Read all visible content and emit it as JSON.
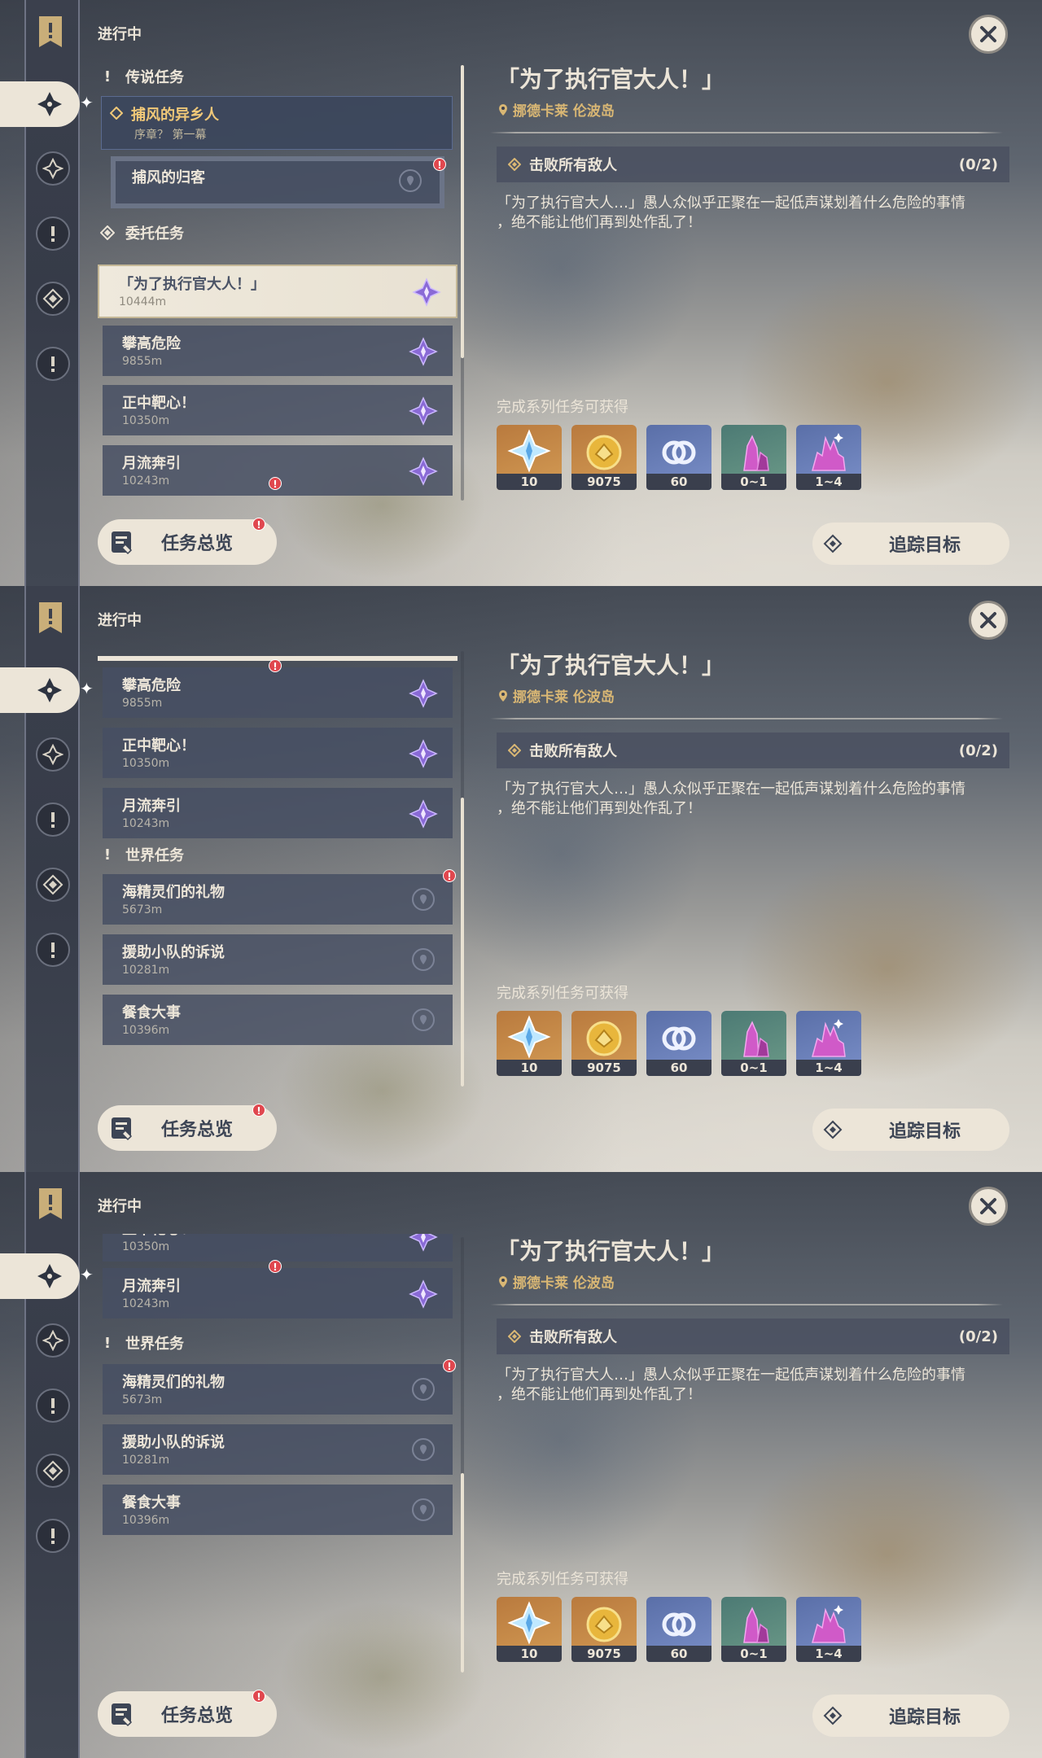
{
  "section_label": "进行中",
  "close_icon": "close-icon",
  "overview_button": {
    "label": "任务总览",
    "badge": "!"
  },
  "track_button": {
    "label": "追踪目标"
  },
  "detail": {
    "title": "「为了执行官大人！」",
    "location": "挪德卡莱 伦波岛",
    "objective": {
      "text": "击败所有敌人",
      "count": "(0/2)"
    },
    "description_lines": [
      "「为了执行官大人…」愚人众似乎正聚在一起低声谋划着什么危险的事情",
      "，绝不能让他们再到处作乱了！"
    ],
    "rewards_label": "完成系列任务可获得",
    "rewards": [
      {
        "icon": "primogem-icon",
        "count": "10"
      },
      {
        "icon": "mora-icon",
        "count": "9075"
      },
      {
        "icon": "companionship-exp-icon",
        "count": "60"
      },
      {
        "icon": "crystal-ore-icon",
        "count": "0~1"
      },
      {
        "icon": "crystal-chunk-icon",
        "count": "1~4"
      }
    ]
  },
  "categories": {
    "legend": "传说任务",
    "commission": "委托任务",
    "world": "世界任务"
  },
  "quests": {
    "legend_quest": {
      "title": "捕风的异乡人",
      "subtitle": "序章？ 第一幕"
    },
    "legend_sub": {
      "title": "捕风的归客"
    },
    "c1": {
      "title": "「为了执行官大人！」",
      "distance": "10444m"
    },
    "c2": {
      "title": "攀高危险",
      "distance": "9855m"
    },
    "c3": {
      "title": "正中靶心！",
      "distance": "10350m"
    },
    "c4": {
      "title": "月流奔引",
      "distance": "10243m"
    },
    "w1": {
      "title": "海精灵们的礼物",
      "distance": "5673m"
    },
    "w2": {
      "title": "援助小队的诉说",
      "distance": "10281m"
    },
    "w3": {
      "title": "餐食大事",
      "distance": "10396m"
    }
  },
  "colors": {
    "accent": "#d9b774",
    "panel": "#ece5d8",
    "badge": "#e0474e"
  }
}
